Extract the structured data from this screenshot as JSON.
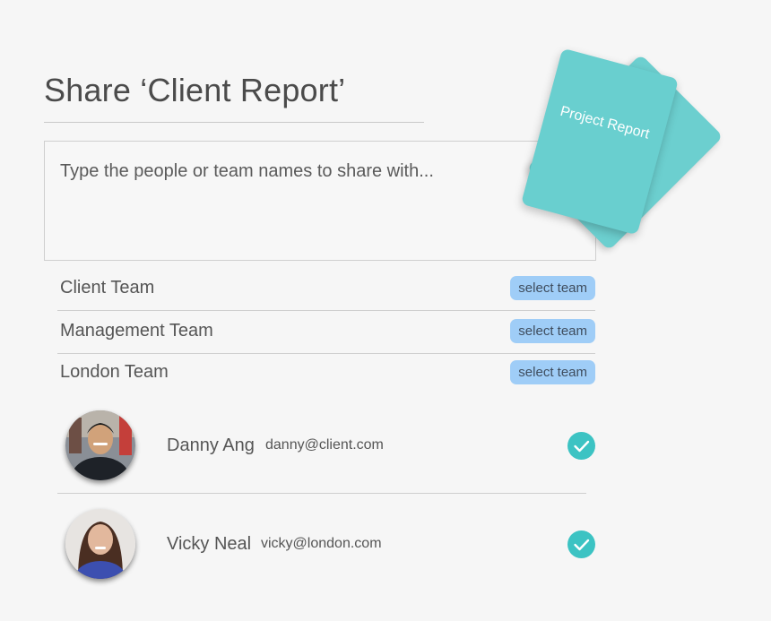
{
  "dialog": {
    "title": "Share ‘Client Report’",
    "share_placeholder": "Type the people or team names to share with..."
  },
  "card": {
    "label": "Project Report",
    "color": "#69cfcf"
  },
  "teams": [
    {
      "name": "Client Team",
      "action": "select team"
    },
    {
      "name": "Management Team",
      "action": "select team"
    },
    {
      "name": "London Team",
      "action": "select team"
    }
  ],
  "people": [
    {
      "name": "Danny Ang",
      "email": "danny@client.com",
      "selected": true
    },
    {
      "name": "Vicky Neal",
      "email": "vicky@london.com",
      "selected": true
    }
  ],
  "colors": {
    "accent": "#3cc3c3",
    "select_team_bg": "#9fcdf7"
  }
}
